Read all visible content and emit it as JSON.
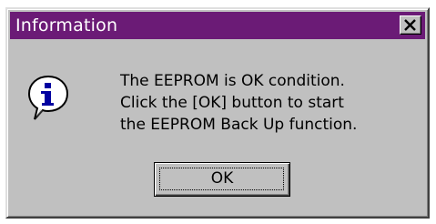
{
  "dialog": {
    "title": "Information",
    "close_icon": "close-icon",
    "icon": "info-icon",
    "message_lines": [
      "The EEPROM is OK condition.",
      "Click the [OK] button to start",
      "the EEPROM Back Up function."
    ],
    "ok_label": "OK"
  },
  "colors": {
    "titlebar": "#6b1b76",
    "face": "#c0c0c0",
    "icon_blue": "#0000a0"
  }
}
